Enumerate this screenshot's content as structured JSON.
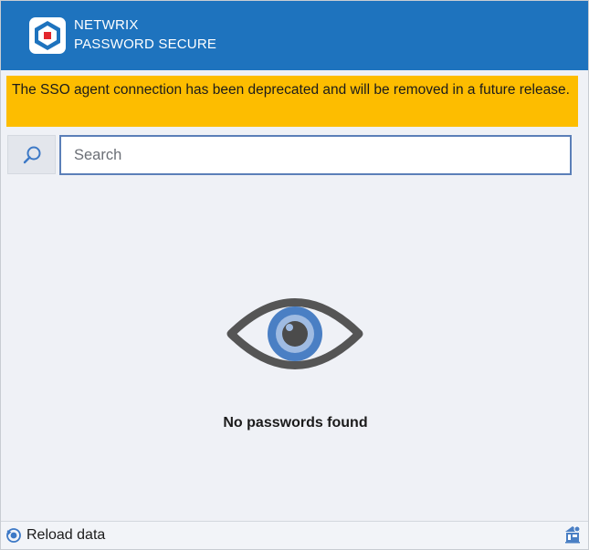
{
  "header": {
    "brand_line1": "NETWRIX",
    "brand_line2": "PASSWORD SECURE",
    "logo_icon": "netwrix-logo-icon",
    "background_color": "#1e73be"
  },
  "banner": {
    "text": "The SSO agent connection has been deprecated and will be removed in a future release.",
    "background_color": "#fdbd00"
  },
  "search": {
    "icon": "search-icon",
    "placeholder": "Search",
    "value": ""
  },
  "empty_state": {
    "icon": "eye-icon",
    "message": "No passwords found"
  },
  "footer": {
    "reload_icon": "reload-icon",
    "reload_label": "Reload data",
    "settings_icon": "settings-icon"
  }
}
